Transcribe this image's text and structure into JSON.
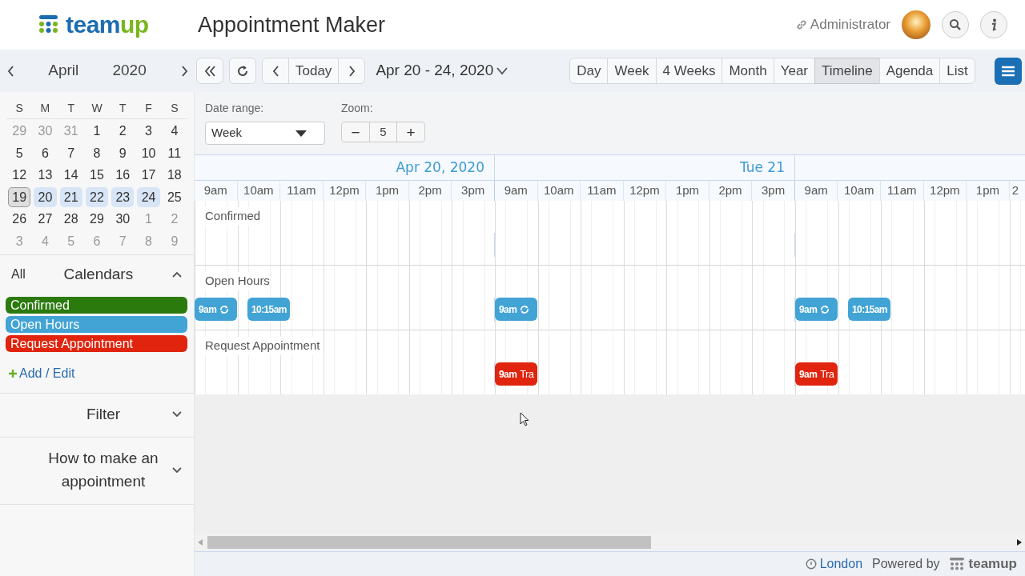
{
  "header": {
    "logo_word_1": "team",
    "logo_word_2": "up",
    "title": "Appointment Maker",
    "user": "Administrator"
  },
  "mini_calendar": {
    "month": "April",
    "year": "2020",
    "weekdays": [
      "S",
      "M",
      "T",
      "W",
      "T",
      "F",
      "S"
    ],
    "days": [
      {
        "d": "29",
        "muted": true,
        "selected": false,
        "in_range": false
      },
      {
        "d": "30",
        "muted": true,
        "selected": false,
        "in_range": false
      },
      {
        "d": "31",
        "muted": true,
        "selected": false,
        "in_range": false
      },
      {
        "d": "1",
        "muted": false,
        "selected": false,
        "in_range": false
      },
      {
        "d": "2",
        "muted": false,
        "selected": false,
        "in_range": false
      },
      {
        "d": "3",
        "muted": false,
        "selected": false,
        "in_range": false
      },
      {
        "d": "4",
        "muted": false,
        "selected": false,
        "in_range": false
      },
      {
        "d": "5",
        "muted": false,
        "selected": false,
        "in_range": false
      },
      {
        "d": "6",
        "muted": false,
        "selected": false,
        "in_range": false
      },
      {
        "d": "7",
        "muted": false,
        "selected": false,
        "in_range": false
      },
      {
        "d": "8",
        "muted": false,
        "selected": false,
        "in_range": false
      },
      {
        "d": "9",
        "muted": false,
        "selected": false,
        "in_range": false
      },
      {
        "d": "10",
        "muted": false,
        "selected": false,
        "in_range": false
      },
      {
        "d": "11",
        "muted": false,
        "selected": false,
        "in_range": false
      },
      {
        "d": "12",
        "muted": false,
        "selected": false,
        "in_range": false
      },
      {
        "d": "13",
        "muted": false,
        "selected": false,
        "in_range": false
      },
      {
        "d": "14",
        "muted": false,
        "selected": false,
        "in_range": false
      },
      {
        "d": "15",
        "muted": false,
        "selected": false,
        "in_range": false
      },
      {
        "d": "16",
        "muted": false,
        "selected": false,
        "in_range": false
      },
      {
        "d": "17",
        "muted": false,
        "selected": false,
        "in_range": false
      },
      {
        "d": "18",
        "muted": false,
        "selected": false,
        "in_range": false
      },
      {
        "d": "19",
        "muted": false,
        "selected": true,
        "in_range": false
      },
      {
        "d": "20",
        "muted": false,
        "selected": false,
        "in_range": true
      },
      {
        "d": "21",
        "muted": false,
        "selected": false,
        "in_range": true
      },
      {
        "d": "22",
        "muted": false,
        "selected": false,
        "in_range": true
      },
      {
        "d": "23",
        "muted": false,
        "selected": false,
        "in_range": true
      },
      {
        "d": "24",
        "muted": false,
        "selected": false,
        "in_range": true
      },
      {
        "d": "25",
        "muted": false,
        "selected": false,
        "in_range": false
      },
      {
        "d": "26",
        "muted": false,
        "selected": false,
        "in_range": false
      },
      {
        "d": "27",
        "muted": false,
        "selected": false,
        "in_range": false
      },
      {
        "d": "28",
        "muted": false,
        "selected": false,
        "in_range": false
      },
      {
        "d": "29",
        "muted": false,
        "selected": false,
        "in_range": false
      },
      {
        "d": "30",
        "muted": false,
        "selected": false,
        "in_range": false
      },
      {
        "d": "1",
        "muted": true,
        "selected": false,
        "in_range": false
      },
      {
        "d": "2",
        "muted": true,
        "selected": false,
        "in_range": false
      },
      {
        "d": "3",
        "muted": true,
        "selected": false,
        "in_range": false
      },
      {
        "d": "4",
        "muted": true,
        "selected": false,
        "in_range": false
      },
      {
        "d": "5",
        "muted": true,
        "selected": false,
        "in_range": false
      },
      {
        "d": "6",
        "muted": true,
        "selected": false,
        "in_range": false
      },
      {
        "d": "7",
        "muted": true,
        "selected": false,
        "in_range": false
      },
      {
        "d": "8",
        "muted": true,
        "selected": false,
        "in_range": false
      },
      {
        "d": "9",
        "muted": true,
        "selected": false,
        "in_range": false
      }
    ]
  },
  "calendars_panel": {
    "all_label": "All",
    "title": "Calendars",
    "expanded": true,
    "add_label": "Add / Edit",
    "calendars": [
      {
        "name": "Confirmed",
        "color": "#2b7a0e"
      },
      {
        "name": "Open Hours",
        "color": "#42a3d5"
      },
      {
        "name": "Request Appointment",
        "color": "#e0240d"
      }
    ]
  },
  "panels": [
    {
      "title": "Filter",
      "expanded": false
    },
    {
      "title": "How to make an appointment",
      "expanded": false
    }
  ],
  "toolbar": {
    "today": "Today",
    "date_range": "Apr 20 - 24, 2020",
    "views": [
      {
        "label": "Day",
        "selected": false
      },
      {
        "label": "Week",
        "selected": false
      },
      {
        "label": "4 Weeks",
        "selected": false
      },
      {
        "label": "Month",
        "selected": false
      },
      {
        "label": "Year",
        "selected": false
      },
      {
        "label": "Timeline",
        "selected": true
      },
      {
        "label": "Agenda",
        "selected": false
      },
      {
        "label": "List",
        "selected": false
      }
    ]
  },
  "options": {
    "date_range_label": "Date range:",
    "date_range_value": "Week",
    "zoom_label": "Zoom:",
    "zoom_minus": "−",
    "zoom_value": "5",
    "zoom_plus": "+"
  },
  "timeline": {
    "days": [
      {
        "title": "Apr 20, 2020",
        "hours": [
          "9am",
          "10am",
          "11am",
          "12pm",
          "1pm",
          "2pm",
          "3pm"
        ]
      },
      {
        "title": "Tue 21",
        "hours": [
          "9am",
          "10am",
          "11am",
          "12pm",
          "1pm",
          "2pm",
          "3pm"
        ]
      },
      {
        "hours": [
          "9am",
          "10am",
          "11am",
          "12pm",
          "1pm",
          "2"
        ]
      }
    ],
    "rows": [
      {
        "name": "Confirmed"
      },
      {
        "name": "Open Hours",
        "events": [
          {
            "kind": "monday",
            "time": "9am",
            "recurring": true
          },
          {
            "kind": "monday",
            "time": "10:15am",
            "recurring": false
          },
          {
            "kind": "tuesday",
            "time": "9am",
            "recurring": true
          },
          {
            "kind": "wednesday",
            "time": "9am",
            "recurring": true
          },
          {
            "kind": "wednesday",
            "time": "10:15am",
            "recurring": false
          }
        ]
      },
      {
        "name": "Request Appointment",
        "events": [
          {
            "kind": "tuesday",
            "time": "9am",
            "title": "Tra",
            "recurring": false
          },
          {
            "kind": "wednesday",
            "time": "9am",
            "title": "Tra",
            "recurring": false
          }
        ]
      }
    ]
  },
  "footer": {
    "timezone": "London",
    "powered_by": "Powered by",
    "brand": "teamup"
  }
}
